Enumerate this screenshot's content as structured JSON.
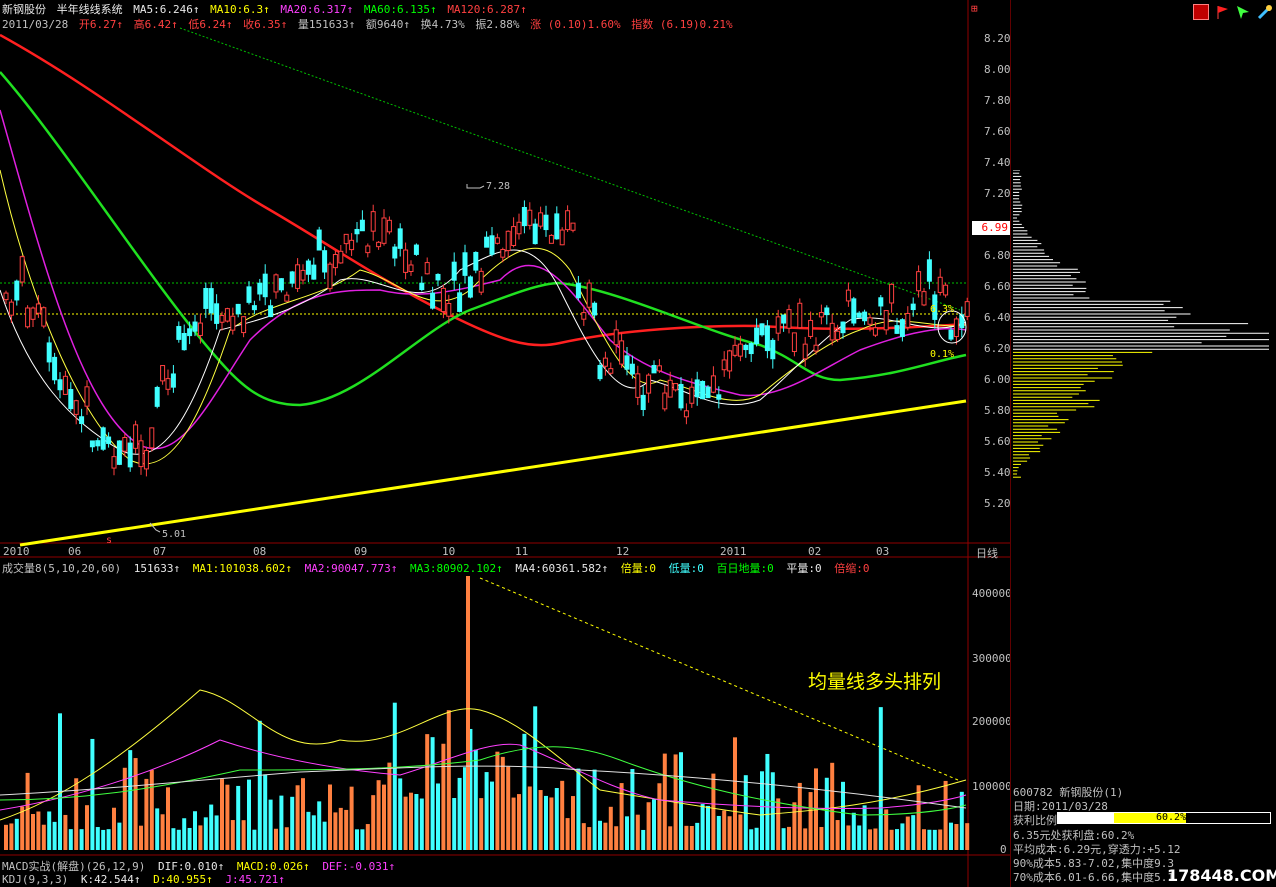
{
  "header": {
    "stock_name": "新钢股份",
    "system": "半年线线系统",
    "ma5": "MA5:6.246↑",
    "ma10": "MA10:6.3↑",
    "ma20": "MA20:6.317↑",
    "ma60": "MA60:6.135↑",
    "ma120": "MA120:6.287↑",
    "date": "2011/03/28",
    "open": "开6.27↑",
    "high": "高6.42↑",
    "low": "低6.24↑",
    "close": "收6.35↑",
    "vol": "量151633↑",
    "amount": "额9640↑",
    "turnover": "换4.73%",
    "amplitude": "振2.88%",
    "change": "涨 (0.10)1.60%",
    "index": "指数 (6.19)0.21%"
  },
  "price_axis": [
    "8.20",
    "8.00",
    "7.80",
    "7.60",
    "7.40",
    "7.20",
    "6.99",
    "6.80",
    "6.60",
    "6.40",
    "6.20",
    "6.00",
    "5.80",
    "5.60",
    "5.40",
    "5.20"
  ],
  "date_axis": [
    "2010",
    "06",
    "07",
    "08",
    "09",
    "10",
    "11",
    "12",
    "2011",
    "02",
    "03"
  ],
  "period": "日线",
  "annotations": {
    "high": "7.28",
    "low": "5.01",
    "p1": "6.3%",
    "p2": "0.1%",
    "slogan": "均量线多头排列"
  },
  "vol_indicator": {
    "name": "成交量8(5,10,20,60)",
    "v": "151633↑",
    "ma1": "MA1:101038.602↑",
    "ma2": "MA2:90047.773↑",
    "ma3": "MA3:80902.102↑",
    "ma4": "MA4:60361.582↑",
    "bei": "倍量:0",
    "di": "低量:0",
    "bai": "百日地量:0",
    "ping": "平量:0",
    "suo": "倍缩:0"
  },
  "vol_axis": [
    "400000",
    "300000",
    "200000",
    "100000",
    "0"
  ],
  "macd": {
    "name": "MACD实战(解盘)(26,12,9)",
    "dif": "DIF:0.010↑",
    "macd": "MACD:0.026↑",
    "def": "DEF:-0.031↑"
  },
  "kdj": {
    "name": "KDJ(9,3,3)",
    "k": "K:42.544↑",
    "d": "D:40.955↑",
    "j": "J:45.721↑"
  },
  "info": {
    "code": "600782  新钢股份(1)",
    "date": "日期:2011/03/28",
    "profit_label": "获利比例:",
    "profit_value": "60.2%",
    "profit_pct": 0.602,
    "line1": "6.35元处获利盘:60.2%",
    "line2": "平均成本:6.29元,穿透力:+5.12",
    "line3": "90%成本5.83-7.02,集中度9.3",
    "line4": "70%成本6.01-6.66,集中度5.1",
    "watermark": "178448.COM"
  }
}
